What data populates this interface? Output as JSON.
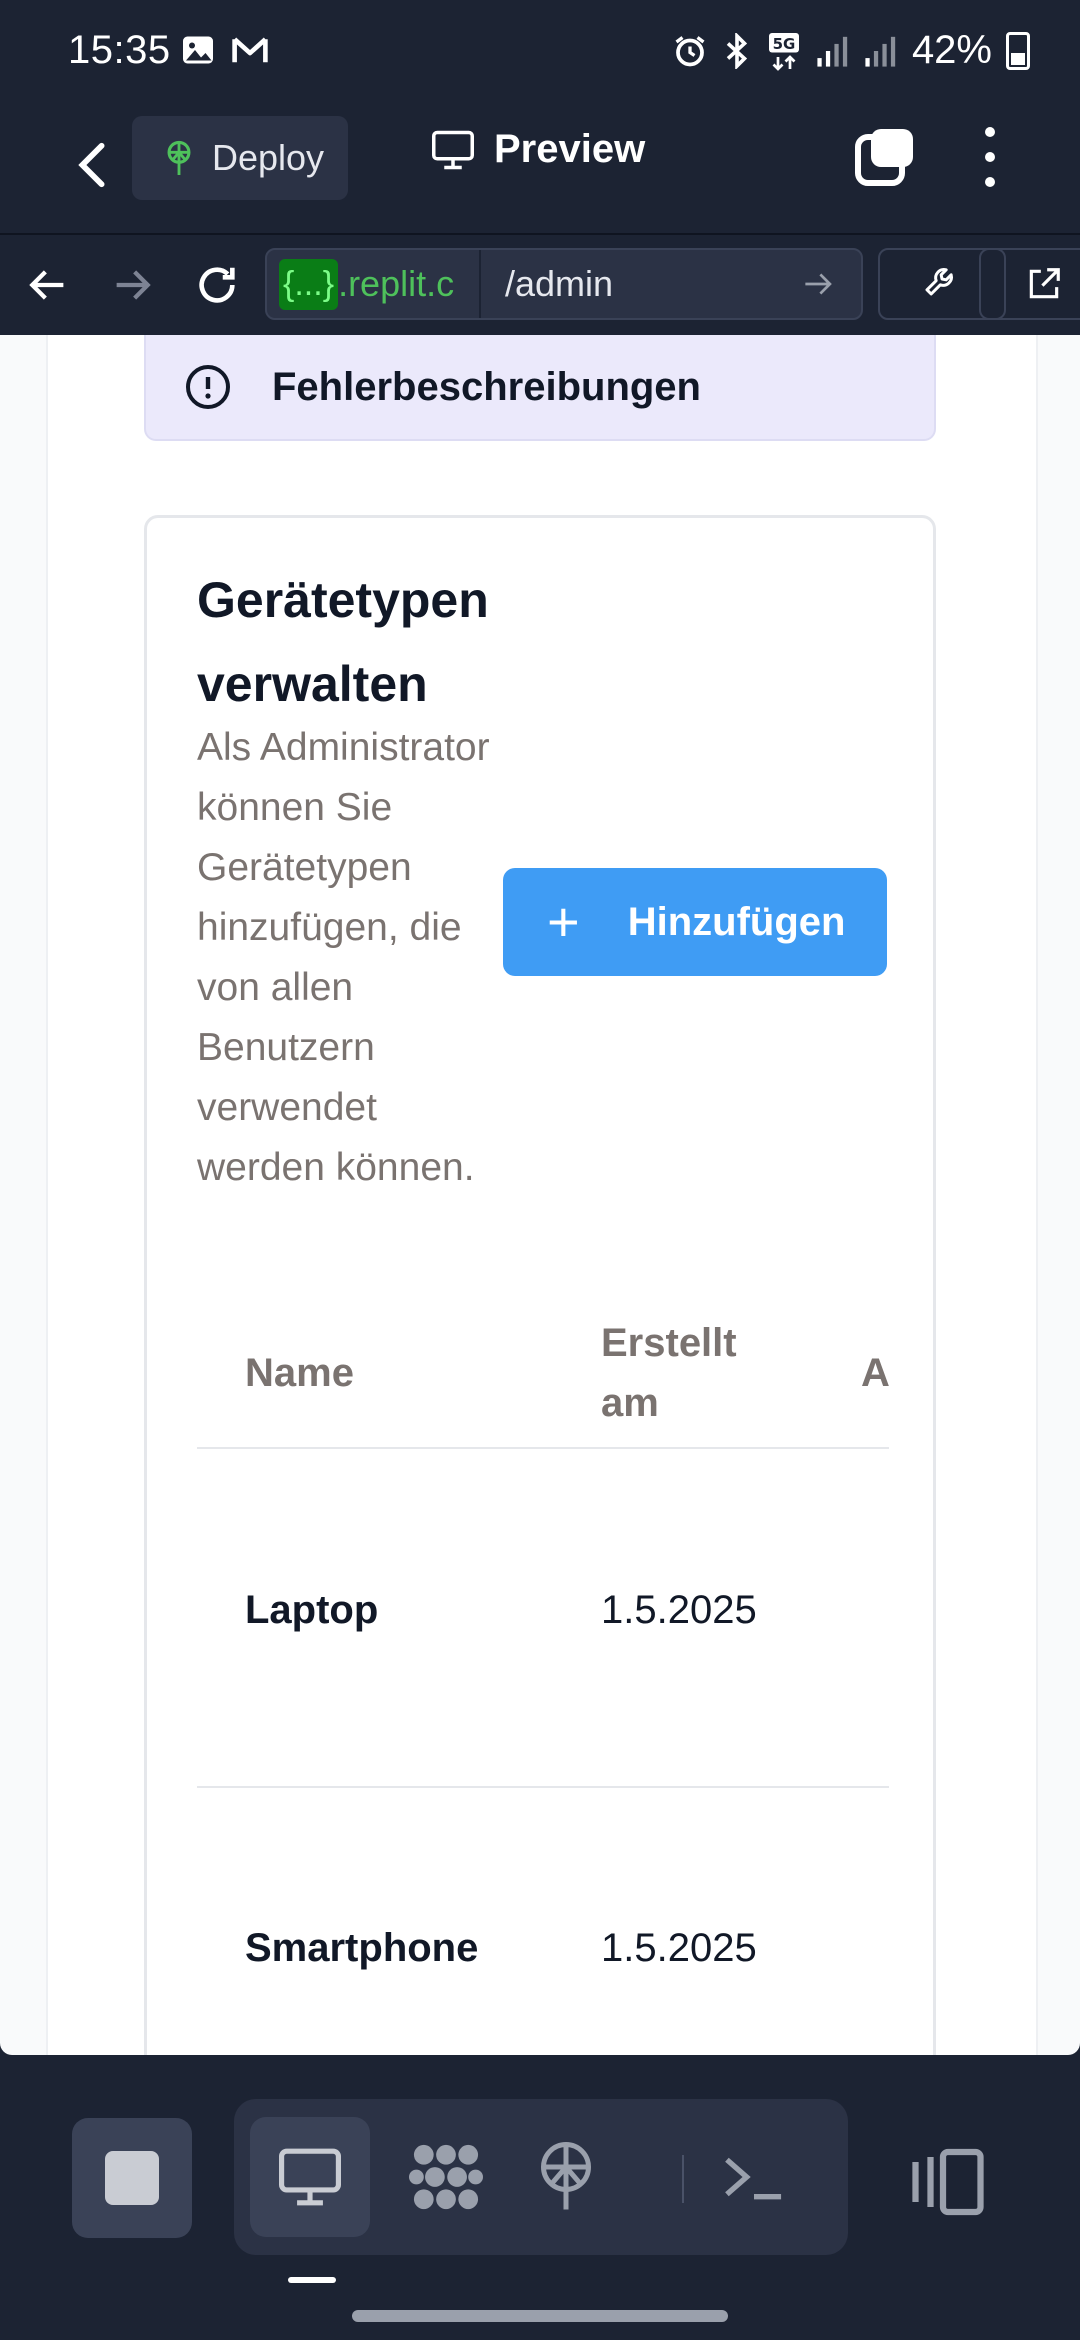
{
  "status_bar": {
    "time": "15:35",
    "battery": "42%",
    "network": "5G"
  },
  "app_bar": {
    "deploy_label": "Deploy",
    "preview_label": "Preview"
  },
  "url_bar": {
    "host_braces": "{...}",
    "host_suffix": ".replit.c",
    "path": "/admin"
  },
  "alert": {
    "text": "Fehlerbeschreibungen"
  },
  "card": {
    "title": "Gerätetypen verwalten",
    "description": "Als Administrator können Sie Gerätetypen hinzufügen, die von allen Benutzern verwendet werden können.",
    "add_button_label": "Hinzufügen",
    "table": {
      "headers": [
        "Name",
        "Erstellt am",
        "A"
      ],
      "rows": [
        {
          "name": "Laptop",
          "created": "1.5.2025"
        },
        {
          "name": "Smartphone",
          "created": "1.5.2025"
        }
      ]
    }
  },
  "colors": {
    "chrome_bg": "#1c2333",
    "accent_blue": "#3f9cf4",
    "alert_bg": "#ebe9fb",
    "url_green": "#4ec15b"
  }
}
